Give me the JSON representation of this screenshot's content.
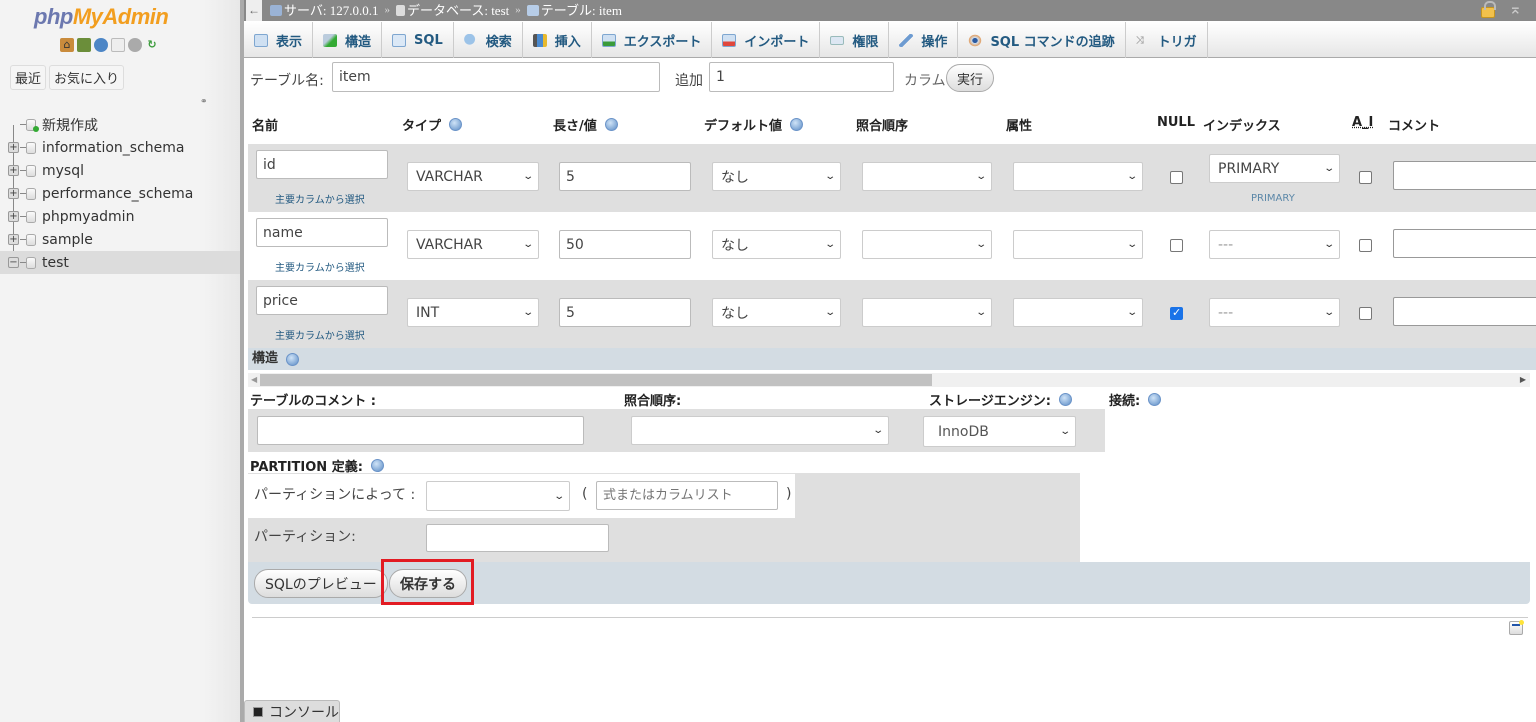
{
  "sidebar": {
    "logo_php": "php",
    "logo_my": "MyAdmin",
    "nav_icons": [
      "home-icon",
      "logout-icon",
      "help-icon",
      "docs-icon",
      "settings-icon",
      "reload-icon"
    ],
    "recent_label": "最近",
    "favorites_label": "お気に入り",
    "tree": [
      {
        "label": "新規作成",
        "type": "new"
      },
      {
        "label": "information_schema",
        "type": "db"
      },
      {
        "label": "mysql",
        "type": "db"
      },
      {
        "label": "performance_schema",
        "type": "db"
      },
      {
        "label": "phpmyadmin",
        "type": "db"
      },
      {
        "label": "sample",
        "type": "db"
      },
      {
        "label": "test",
        "type": "db",
        "expanded": true,
        "selected": true
      }
    ]
  },
  "breadcrumb": {
    "server": "サーバ: 127.0.0.1",
    "database": "データベース: test",
    "table": "テーブル: item",
    "separator": "»"
  },
  "tabs": [
    {
      "label": "表示",
      "icon": "browse-icon"
    },
    {
      "label": "構造",
      "icon": "structure-icon"
    },
    {
      "label": "SQL",
      "icon": "sql-icon"
    },
    {
      "label": "検索",
      "icon": "search-icon"
    },
    {
      "label": "挿入",
      "icon": "insert-icon"
    },
    {
      "label": "エクスポート",
      "icon": "export-icon"
    },
    {
      "label": "インポート",
      "icon": "import-icon"
    },
    {
      "label": "権限",
      "icon": "privileges-icon"
    },
    {
      "label": "操作",
      "icon": "operations-icon"
    },
    {
      "label": "SQL コマンドの追跡",
      "icon": "tracking-icon"
    },
    {
      "label": "トリガ",
      "icon": "triggers-icon"
    }
  ],
  "form": {
    "table_name_label": "テーブル名:",
    "table_name_value": "item",
    "add_label": "追加",
    "add_value": "1",
    "columns_label": "カラム",
    "execute_button": "実行"
  },
  "columns_header": {
    "name": "名前",
    "type": "タイプ",
    "length": "長さ/値",
    "default": "デフォルト値",
    "collation": "照合順序",
    "attributes": "属性",
    "null": "NULL",
    "index": "インデックス",
    "ai": "A_I",
    "comment": "コメント"
  },
  "pick_from_central": "主要カラムから選択",
  "rows": [
    {
      "name": "id",
      "type": "VARCHAR",
      "length": "5",
      "default": "なし",
      "collation": "",
      "attributes": "",
      "null": false,
      "index": "PRIMARY",
      "index_sub": "PRIMARY",
      "ai": false,
      "comment": ""
    },
    {
      "name": "name",
      "type": "VARCHAR",
      "length": "50",
      "default": "なし",
      "collation": "",
      "attributes": "",
      "null": false,
      "index": "---",
      "index_sub": "",
      "ai": false,
      "comment": ""
    },
    {
      "name": "price",
      "type": "INT",
      "length": "5",
      "default": "なし",
      "collation": "",
      "attributes": "",
      "null": true,
      "index": "---",
      "index_sub": "",
      "ai": false,
      "comment": ""
    }
  ],
  "structure_label": "構造",
  "table_options": {
    "comment_label": "テーブルのコメント :",
    "comment_value": "",
    "collation_label": "照合順序:",
    "collation_value": "",
    "engine_label": "ストレージエンジン:",
    "engine_value": "InnoDB",
    "connection_label": "接続:"
  },
  "partition": {
    "title": "PARTITION 定義:",
    "by_label": "パーティションによって :",
    "by_value": "",
    "expr_placeholder": "式またはカラムリスト",
    "open_paren": "(",
    "close_paren": ")",
    "partitions_label": "パーティション:",
    "partitions_value": ""
  },
  "actions": {
    "preview_sql": "SQLのプレビュー",
    "save": "保存する"
  },
  "console_label": "コンソール",
  "colors": {
    "highlight": "#e21b23",
    "row_odd": "#dfdfdf",
    "header_bar": "#d3dce3",
    "link": "#235a81"
  }
}
